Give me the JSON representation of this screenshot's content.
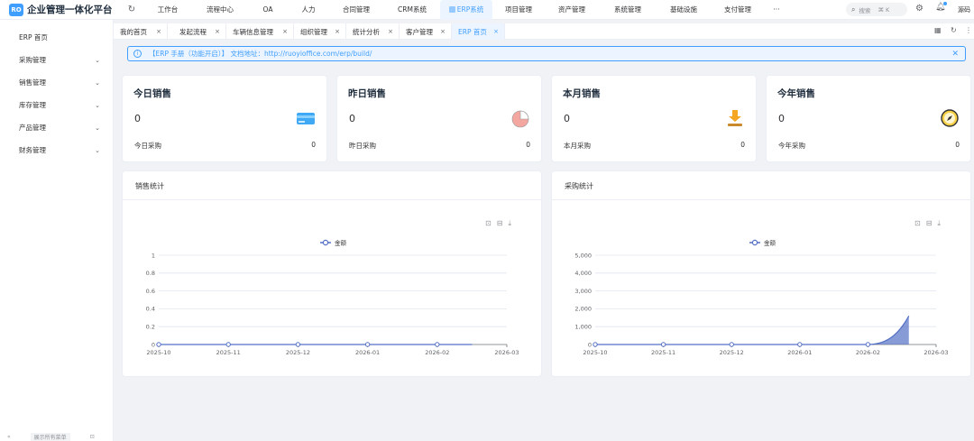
{
  "app": {
    "logo_text": "RO",
    "title": "企业管理一体化平台"
  },
  "topnav": {
    "items": [
      "工作台",
      "流程中心",
      "OA",
      "人力",
      "合同管理",
      "CRM系统",
      "ERP系统",
      "项目管理",
      "资产管理",
      "系统管理",
      "基础设施",
      "支付管理"
    ],
    "active": "ERP系统",
    "more": "···",
    "search_placeholder": "搜索",
    "search_shortcut": "⌘ K",
    "user": "源码"
  },
  "sidebar": {
    "items": [
      {
        "label": "ERP 首页",
        "expandable": false
      },
      {
        "label": "采购管理",
        "expandable": true
      },
      {
        "label": "销售管理",
        "expandable": true
      },
      {
        "label": "库存管理",
        "expandable": true
      },
      {
        "label": "产品管理",
        "expandable": true
      },
      {
        "label": "财务管理",
        "expandable": true
      }
    ],
    "bottom_label": "展示所有菜单"
  },
  "tabs": {
    "items": [
      {
        "label": "我的首页"
      },
      {
        "label": "发起流程"
      },
      {
        "label": "车辆信息管理"
      },
      {
        "label": "组织管理"
      },
      {
        "label": "统计分析"
      },
      {
        "label": "客户管理"
      },
      {
        "label": "ERP 首页"
      }
    ],
    "active": "ERP 首页"
  },
  "alert": {
    "text": "【ERP 手册（功能开启）】 文档地址：http://ruoyioffice.com/erp/build/"
  },
  "cards": [
    {
      "title": "今日销售",
      "value": "0",
      "sub_label": "今日采购",
      "sub_value": "0",
      "icon": "credit-card-icon"
    },
    {
      "title": "昨日销售",
      "value": "0",
      "sub_label": "昨日采购",
      "sub_value": "0",
      "icon": "pie-chart-icon"
    },
    {
      "title": "本月销售",
      "value": "0",
      "sub_label": "本月采购",
      "sub_value": "0",
      "icon": "download-tray-icon"
    },
    {
      "title": "今年销售",
      "value": "0",
      "sub_label": "今年采购",
      "sub_value": "0",
      "icon": "compass-icon"
    }
  ],
  "panels": {
    "sales_title": "销售统计",
    "purchase_title": "采购统计"
  },
  "colors": {
    "accent": "#409eff",
    "line": "#5470c6"
  },
  "chart_data": [
    {
      "type": "line",
      "title": "销售统计",
      "legend": [
        "金额"
      ],
      "x": [
        "2025-10",
        "2025-11",
        "2025-12",
        "2026-01",
        "2026-02",
        "2026-03"
      ],
      "series": [
        {
          "name": "金额",
          "values": [
            0,
            0,
            0,
            0,
            0,
            0
          ]
        }
      ],
      "ylim": [
        0,
        1
      ],
      "yticks": [
        "0",
        "0.2",
        "0.4",
        "0.6",
        "0.8",
        "1"
      ],
      "grid": true
    },
    {
      "type": "area",
      "title": "采购统计",
      "legend": [
        "金额"
      ],
      "x": [
        "2025-10",
        "2025-11",
        "2025-12",
        "2026-01",
        "2026-02",
        "2026-03"
      ],
      "series": [
        {
          "name": "金额",
          "values": [
            0,
            0,
            0,
            0,
            0,
            1600
          ]
        }
      ],
      "ylim": [
        0,
        5000
      ],
      "yticks": [
        "0",
        "1,000",
        "2,000",
        "3,000",
        "4,000",
        "5,000"
      ],
      "grid": true
    }
  ]
}
